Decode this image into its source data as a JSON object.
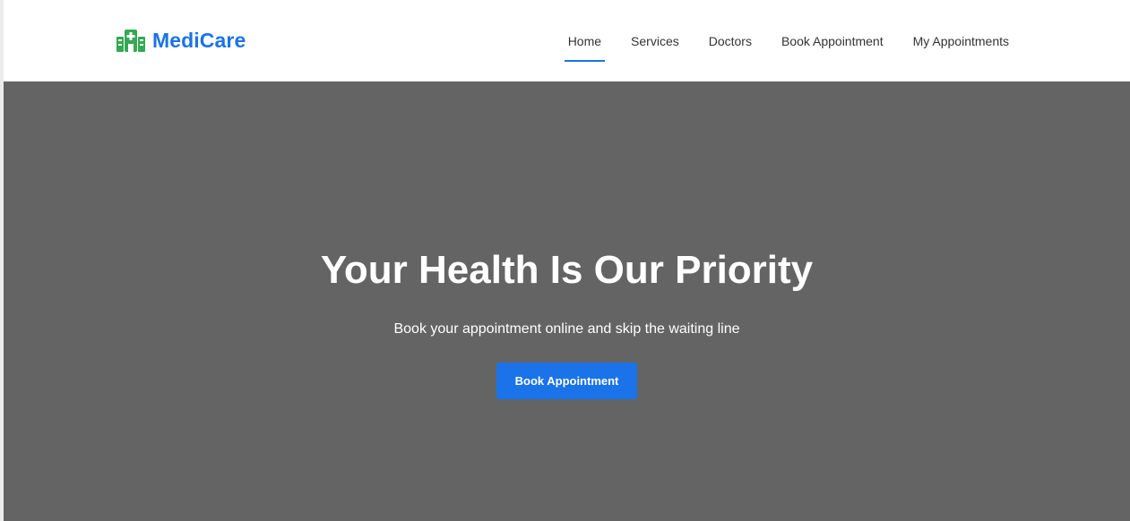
{
  "brand": {
    "name": "MediCare",
    "icon": "hospital-icon",
    "color": "#1a73e8",
    "icon_color": "#34a853"
  },
  "nav": {
    "items": [
      {
        "label": "Home",
        "active": true
      },
      {
        "label": "Services",
        "active": false
      },
      {
        "label": "Doctors",
        "active": false
      },
      {
        "label": "Book Appointment",
        "active": false
      },
      {
        "label": "My Appointments",
        "active": false
      }
    ],
    "active_color": "#1a73e8"
  },
  "hero": {
    "title": "Your Health Is Our Priority",
    "subtitle": "Book your appointment online and skip the waiting line",
    "cta_label": "Book Appointment",
    "background_color": "#646464",
    "cta_color": "#1a73e8"
  }
}
